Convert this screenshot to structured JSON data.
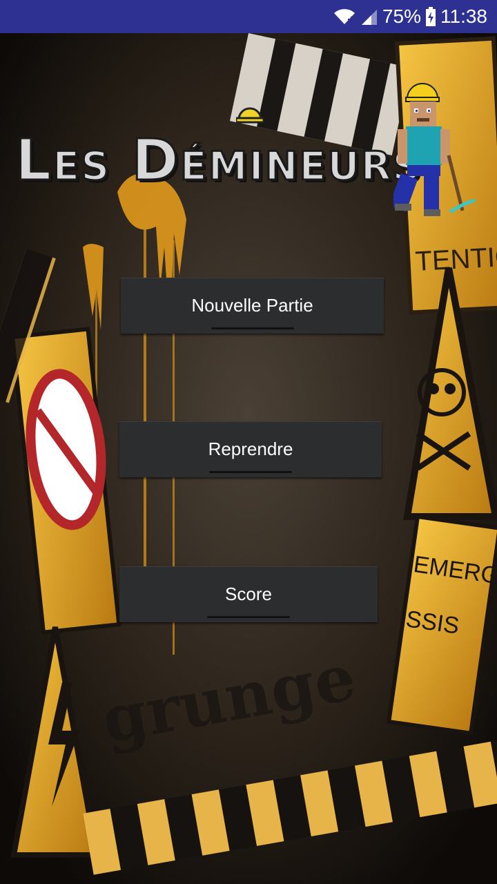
{
  "status_bar": {
    "battery_percent": "75%",
    "time": "11:38",
    "icons": [
      "wifi-icon",
      "signal-icon",
      "battery-icon"
    ]
  },
  "logo": {
    "title": "Les Démineurs"
  },
  "menu": {
    "new_game": "Nouvelle Partie",
    "resume": "Reprendre",
    "score": "Score"
  },
  "colors": {
    "status_bar": "#2e3192",
    "button_bg": "#2b2d2f",
    "accent_yellow": "#f2b21b"
  }
}
